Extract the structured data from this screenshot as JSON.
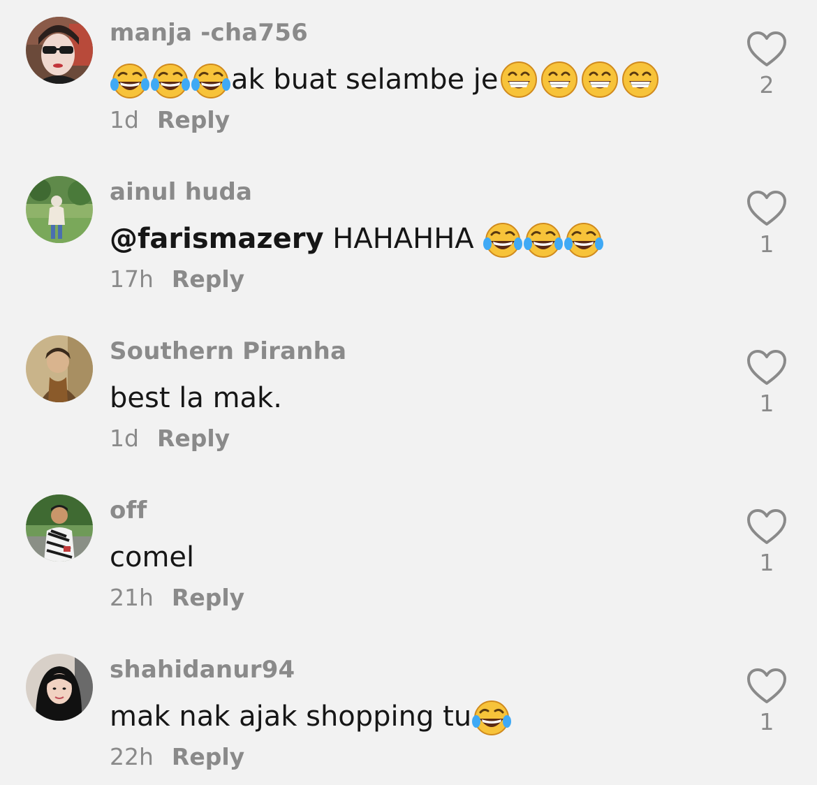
{
  "colors": {
    "background": "#f2f2f2",
    "username": "#8a8a8a",
    "text": "#161616",
    "meta": "#8a8a8a",
    "heart_stroke": "#8a8a8a"
  },
  "comments": [
    {
      "username": "manja -cha756",
      "text_before": "",
      "emojis_before": [
        "face-with-tears-of-joy",
        "face-with-tears-of-joy",
        "face-with-tears-of-joy"
      ],
      "mention": "",
      "text": "ak buat selambe je",
      "emojis_after": [
        "grinning-face-with-smiling-eyes",
        "grinning-face-with-smiling-eyes",
        "grinning-face-with-smiling-eyes",
        "grinning-face-with-smiling-eyes"
      ],
      "time": "1d",
      "reply_label": "Reply",
      "likes": "2",
      "avatar": "avatar-woman-sunglasses"
    },
    {
      "username": "ainul huda",
      "emojis_before": [],
      "mention": "@farismazery",
      "text": " HAHAHHA ",
      "emojis_after": [
        "face-with-tears-of-joy",
        "face-with-tears-of-joy",
        "face-with-tears-of-joy"
      ],
      "time": "17h",
      "reply_label": "Reply",
      "likes": "1",
      "avatar": "avatar-person-field"
    },
    {
      "username": "Southern Piranha",
      "emojis_before": [],
      "mention": "",
      "text": "best la mak.",
      "emojis_after": [],
      "time": "1d",
      "reply_label": "Reply",
      "likes": "1",
      "avatar": "avatar-woman-outdoor"
    },
    {
      "username": "off",
      "emojis_before": [],
      "mention": "",
      "text": "comel",
      "emojis_after": [],
      "time": "21h",
      "reply_label": "Reply",
      "likes": "1",
      "avatar": "avatar-man-striped-shirt"
    },
    {
      "username": "shahidanur94",
      "emojis_before": [],
      "mention": "",
      "text": "mak nak ajak shopping tu",
      "emojis_after": [
        "face-with-tears-of-joy"
      ],
      "time": "22h",
      "reply_label": "Reply",
      "likes": "1",
      "avatar": "avatar-woman-hijab"
    }
  ]
}
